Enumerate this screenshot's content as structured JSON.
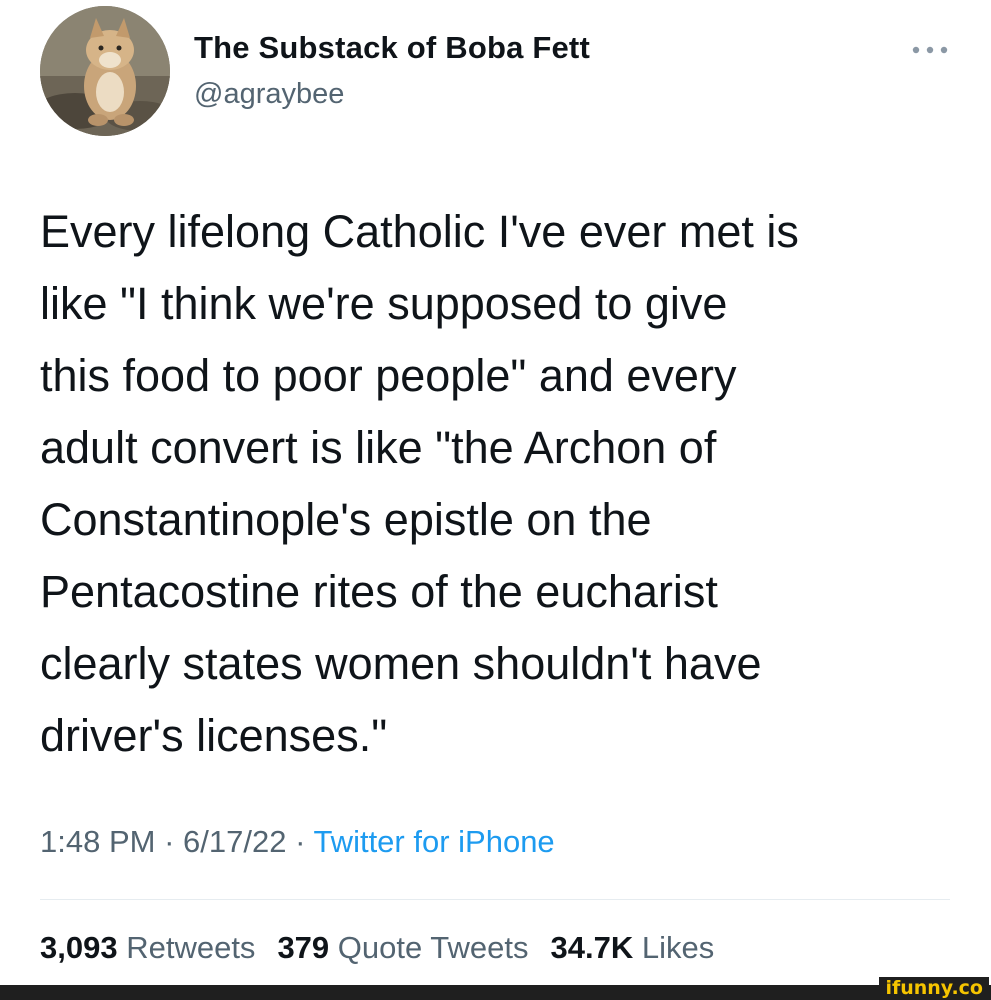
{
  "author": {
    "display_name": "The Substack of Boba Fett",
    "handle": "@agraybee",
    "avatar_icon": "avatar-photo-fox"
  },
  "more_icon": "more-horizontal-icon",
  "tweet": {
    "lines": [
      "Every lifelong Catholic I've ever met is",
      "like \"I think we're supposed to give",
      "this food to poor people\" and every",
      "adult convert is like \"the Archon of",
      "Constantinople's epistle on the",
      "Pentacostine rites of the eucharist",
      "clearly states women shouldn't have",
      "driver's licenses.\""
    ]
  },
  "meta": {
    "time": "1:48 PM",
    "separator": " · ",
    "date": "6/17/22",
    "source": "Twitter for iPhone"
  },
  "stats": {
    "retweets_count": "3,093",
    "retweets_label": "Retweets",
    "quotes_count": "379",
    "quotes_label": "Quote Tweets",
    "likes_count": "34.7K",
    "likes_label": "Likes"
  },
  "watermark": "ifunny.co",
  "colors": {
    "text_primary": "#0f1419",
    "text_secondary": "#536471",
    "link": "#1d9bf0",
    "watermark": "#f5c400"
  }
}
